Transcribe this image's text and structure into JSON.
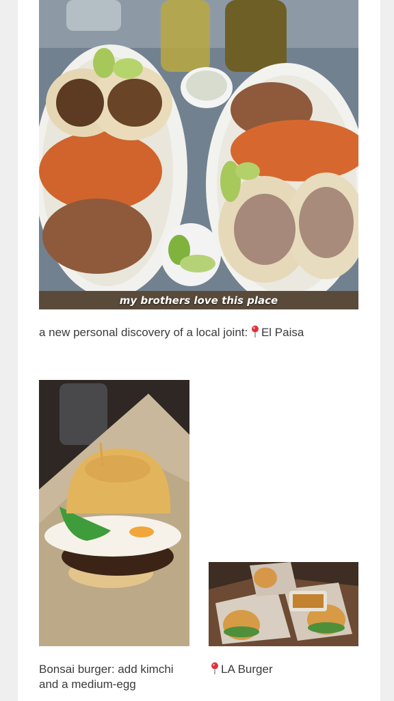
{
  "post1": {
    "overlay_text": "my brothers love this place",
    "caption_text": "a new personal discovery of a local joint:",
    "place": "El Paisa",
    "pin_icon": "location-pin-icon"
  },
  "post2": {
    "caption": "Bonsai burger: add kimchi and a medium-egg"
  },
  "post3": {
    "place": "LA Burger",
    "pin_icon": "location-pin-icon"
  },
  "colors": {
    "pin_red": "#e0313a",
    "text": "#3a3a3a"
  }
}
